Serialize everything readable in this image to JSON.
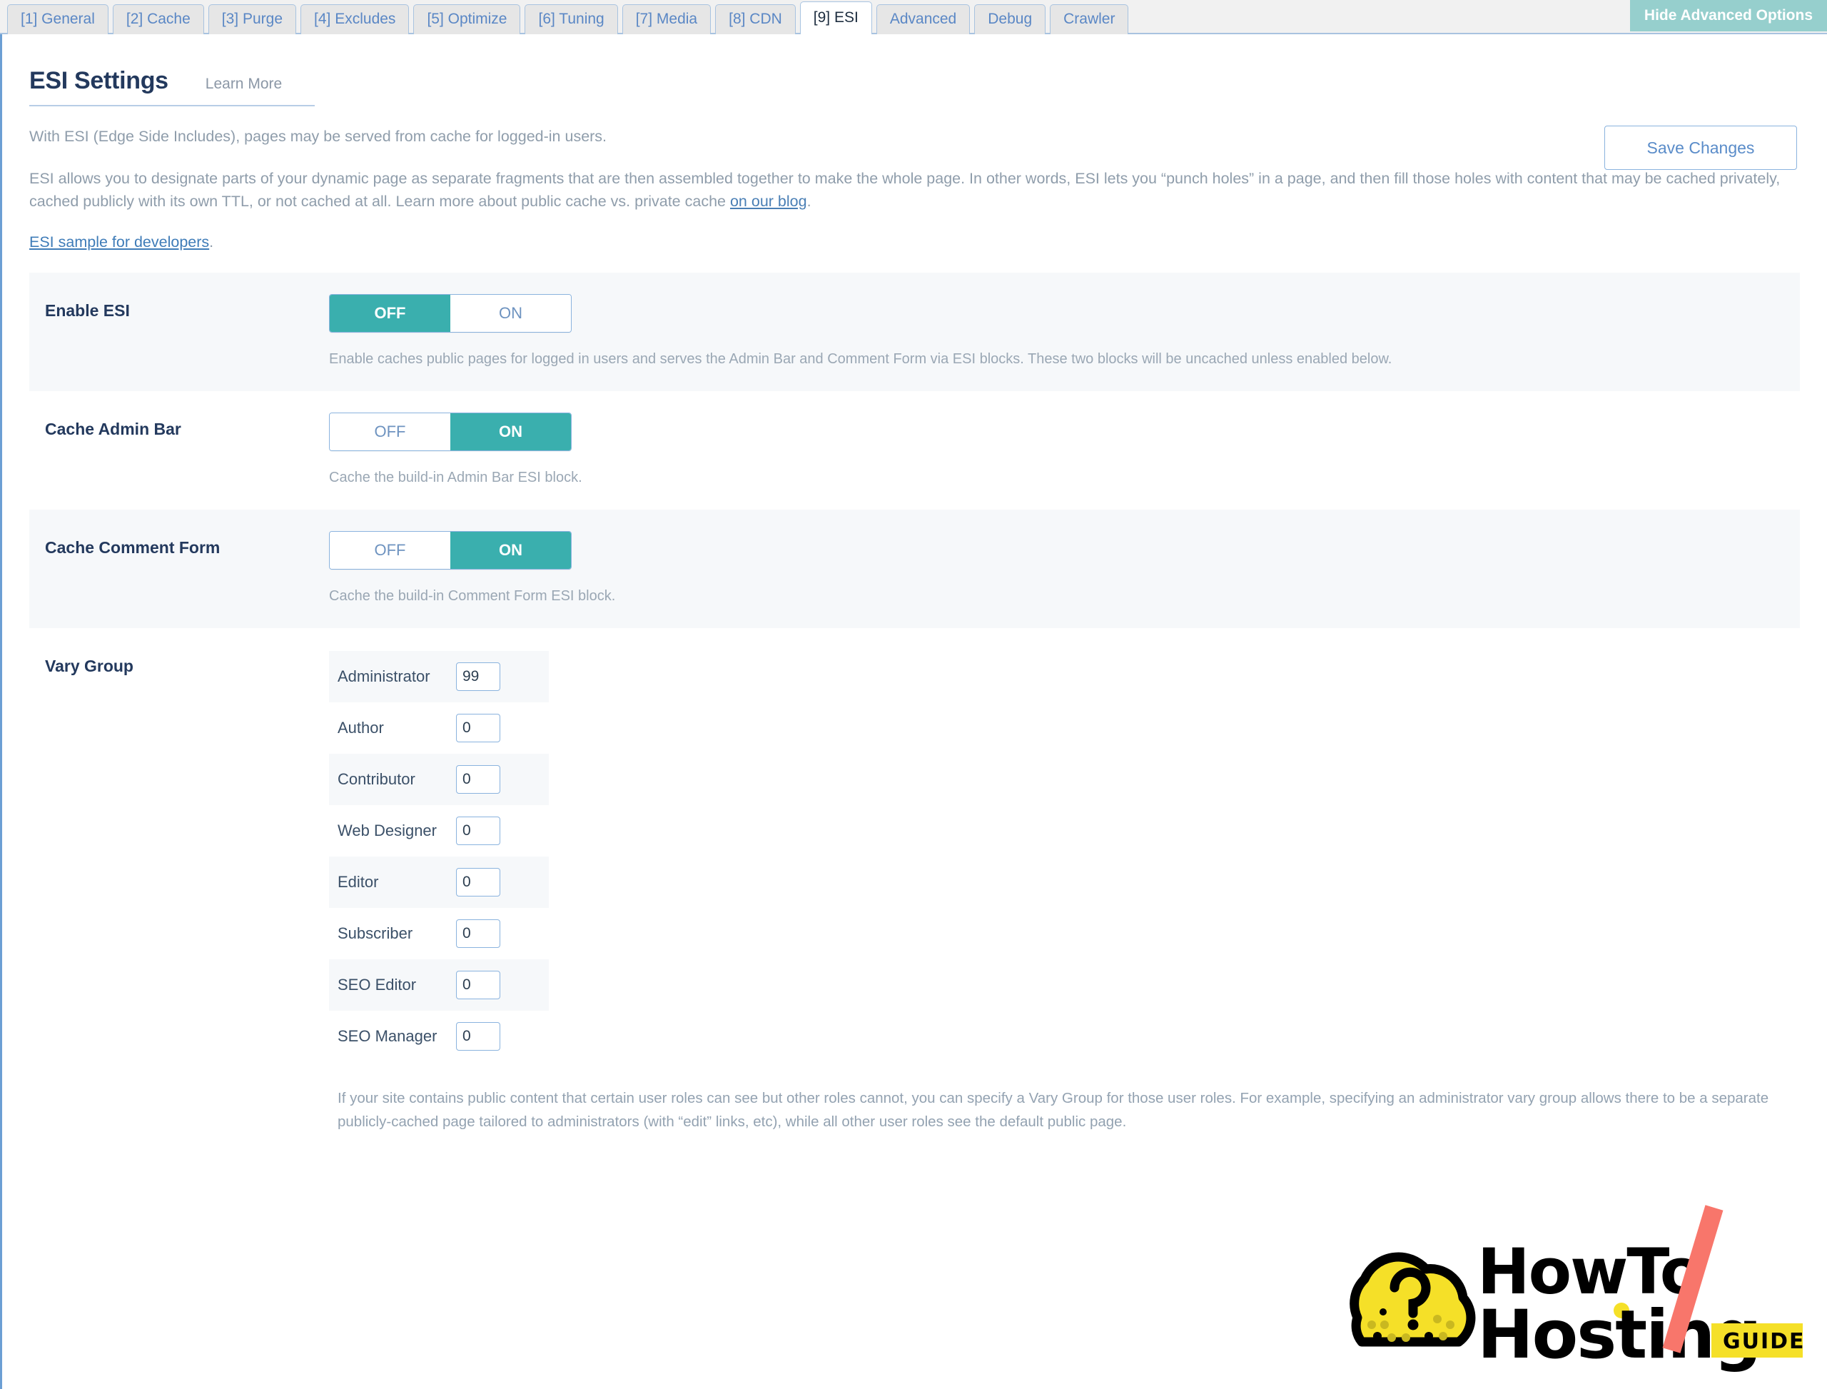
{
  "tabs": [
    {
      "label": "[1] General",
      "active": false
    },
    {
      "label": "[2] Cache",
      "active": false
    },
    {
      "label": "[3] Purge",
      "active": false
    },
    {
      "label": "[4] Excludes",
      "active": false
    },
    {
      "label": "[5] Optimize",
      "active": false
    },
    {
      "label": "[6] Tuning",
      "active": false
    },
    {
      "label": "[7] Media",
      "active": false
    },
    {
      "label": "[8] CDN",
      "active": false
    },
    {
      "label": "[9] ESI",
      "active": true
    },
    {
      "label": "Advanced",
      "active": false
    },
    {
      "label": "Debug",
      "active": false
    },
    {
      "label": "Crawler",
      "active": false
    }
  ],
  "hide_advanced_label": "Hide Advanced Options",
  "header": {
    "title": "ESI Settings",
    "learn_more": "Learn More",
    "save_label": "Save Changes"
  },
  "intro": {
    "p1": "With ESI (Edge Side Includes), pages may be served from cache for logged-in users.",
    "p2_before": "ESI allows you to designate parts of your dynamic page as separate fragments that are then assembled together to make the whole page. In other words, ESI lets you “punch holes” in a page, and then fill those holes with content that may be cached privately, cached publicly with its own TTL, or not cached at all. Learn more about public cache vs. private cache ",
    "p2_link": "on our blog",
    "p2_after": ".",
    "sample_link": "ESI sample for developers",
    "sample_after": "."
  },
  "settings": [
    {
      "label": "Enable ESI",
      "off_label": "OFF",
      "on_label": "ON",
      "selected": "OFF",
      "note": "Enable caches public pages for logged in users and serves the Admin Bar and Comment Form via ESI blocks. These two blocks will be uncached unless enabled below."
    },
    {
      "label": "Cache Admin Bar",
      "off_label": "OFF",
      "on_label": "ON",
      "selected": "ON",
      "note": "Cache the build-in Admin Bar ESI block."
    },
    {
      "label": "Cache Comment Form",
      "off_label": "OFF",
      "on_label": "ON",
      "selected": "ON",
      "note": "Cache the build-in Comment Form ESI block."
    }
  ],
  "vary_group": {
    "label": "Vary Group",
    "rows": [
      {
        "role": "Administrator",
        "value": "99"
      },
      {
        "role": "Author",
        "value": "0"
      },
      {
        "role": "Contributor",
        "value": "0"
      },
      {
        "role": "Web Designer",
        "value": "0"
      },
      {
        "role": "Editor",
        "value": "0"
      },
      {
        "role": "Subscriber",
        "value": "0"
      },
      {
        "role": "SEO Editor",
        "value": "0"
      },
      {
        "role": "SEO Manager",
        "value": "0"
      }
    ],
    "note": "If your site contains public content that certain user roles can see but other roles cannot, you can specify a Vary Group for those user roles. For example, specifying an administrator vary group allows there to be a separate publicly-cached page tailored to administrators (with “edit” links, etc), while all other user roles see the default public page."
  },
  "watermark": {
    "line1": "HowTo",
    "line2": "Hosting",
    "badge": "GUIDE",
    "colors": {
      "yellow": "#F5E028",
      "black": "#000000",
      "red": "#F8766B"
    }
  },
  "colors": {
    "accent_teal": "#3aafae",
    "header_teal": "#96cfcd",
    "link_blue": "#4a7fb5",
    "title_navy": "#23395d",
    "row_shade": "#f6f8fa"
  }
}
